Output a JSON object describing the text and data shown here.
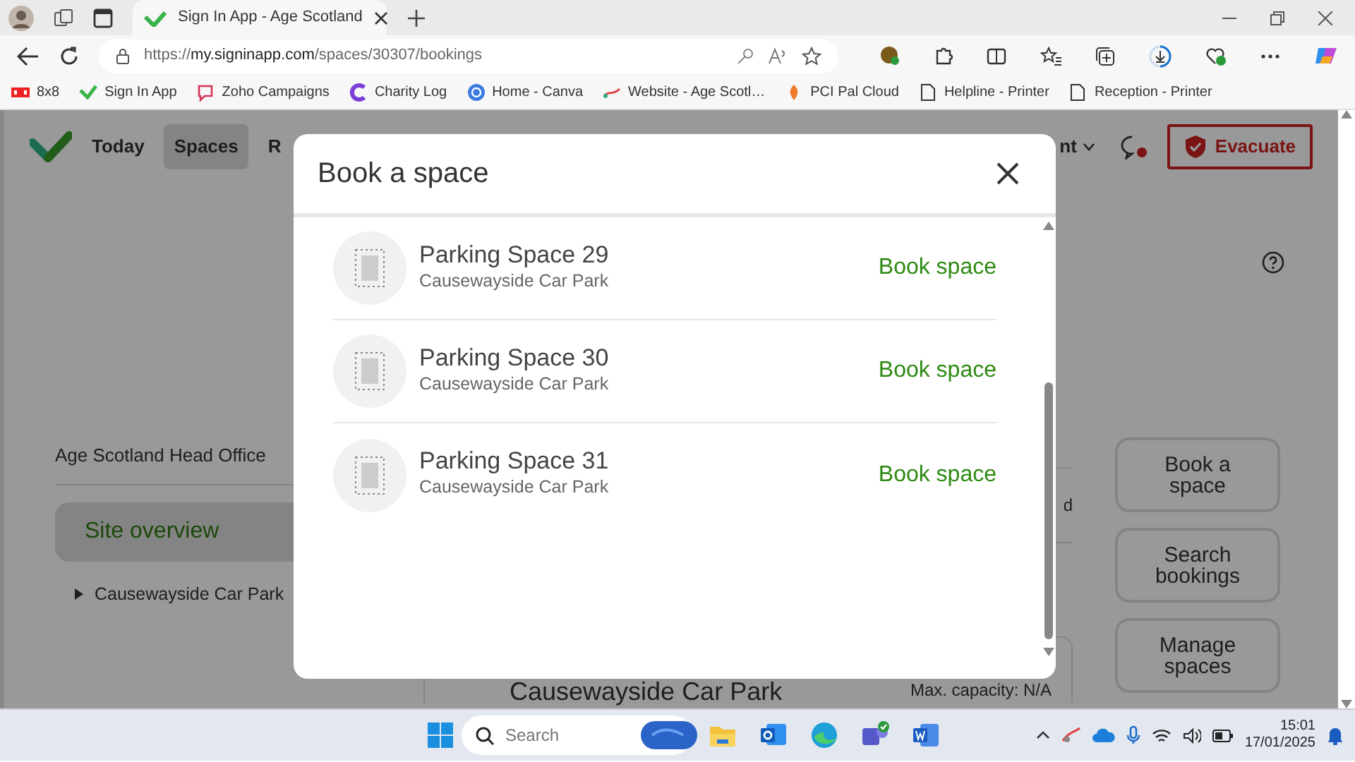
{
  "browser": {
    "tab": {
      "title": "Sign In App - Age Scotland"
    },
    "address": {
      "scheme": "https://",
      "host": "my.signinapp.com",
      "path": "/spaces/30307/bookings"
    },
    "bookmarks": [
      "8x8",
      "Sign In App",
      "Zoho Campaigns",
      "Charity Log",
      "Home - Canva",
      "Website - Age Scotl…",
      "PCI Pal Cloud",
      "Helpline - Printer",
      "Reception - Printer"
    ]
  },
  "page": {
    "nav": [
      {
        "label": "Today",
        "selected": false
      },
      {
        "label": "Spaces",
        "selected": true
      },
      {
        "label": "R",
        "selected": false
      }
    ],
    "nav_partial": "nt",
    "evacuate": "Evacuate",
    "sidebar": {
      "site": "Age Scotland Head Office",
      "items": [
        {
          "label": "Site overview",
          "selected": true
        }
      ],
      "tree": [
        {
          "label": "Causewayside Car Park",
          "expanded": false
        }
      ]
    },
    "center": {
      "partial": "d",
      "card_title": "Causewayside Car Park",
      "capacity": "Max. capacity: N/A"
    },
    "actions": [
      "Book a space",
      "Search bookings",
      "Manage spaces"
    ]
  },
  "modal": {
    "title": "Book a space",
    "spaces": [
      {
        "name": "Parking Space 29",
        "location": "Causewayside Car Park",
        "action": "Book space"
      },
      {
        "name": "Parking Space 30",
        "location": "Causewayside Car Park",
        "action": "Book space"
      },
      {
        "name": "Parking Space 31",
        "location": "Causewayside Car Park",
        "action": "Book space"
      }
    ]
  },
  "taskbar": {
    "search": {
      "placeholder": "Search"
    },
    "time": "15:01",
    "date": "17/01/2025"
  }
}
